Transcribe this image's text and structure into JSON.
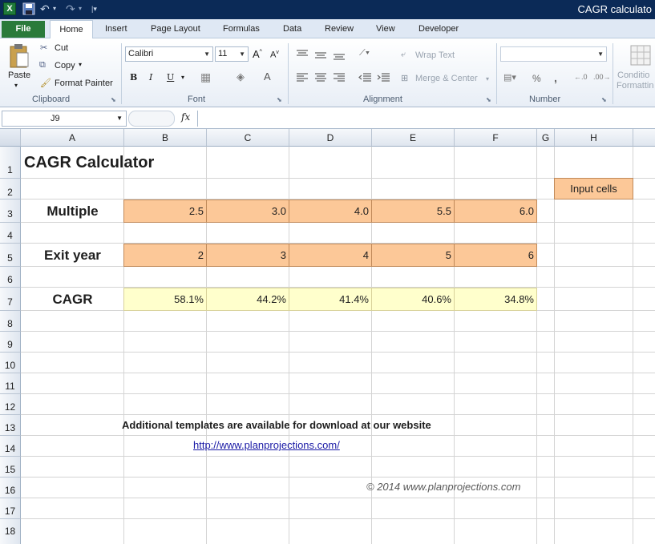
{
  "window": {
    "title": "CAGR calculato"
  },
  "tabs": [
    "File",
    "Home",
    "Insert",
    "Page Layout",
    "Formulas",
    "Data",
    "Review",
    "View",
    "Developer"
  ],
  "ribbon": {
    "clipboard": {
      "paste": "Paste",
      "cut": "Cut",
      "copy": "Copy",
      "format_painter": "Format Painter",
      "group": "Clipboard"
    },
    "font": {
      "name": "Calibri",
      "size": "11",
      "bold": "B",
      "italic": "I",
      "underline": "U",
      "group": "Font"
    },
    "alignment": {
      "wrap": "Wrap Text",
      "merge": "Merge & Center",
      "group": "Alignment"
    },
    "number": {
      "group": "Number",
      "percent": "%",
      "comma": ","
    },
    "styles": {
      "conditional_line1": "Conditio",
      "conditional_line2": "Formattin"
    }
  },
  "formula_bar": {
    "name_box": "J9",
    "fx": "fx",
    "value": ""
  },
  "columns": [
    "A",
    "B",
    "C",
    "D",
    "E",
    "F",
    "G",
    "H"
  ],
  "rows": [
    "1",
    "2",
    "3",
    "4",
    "5",
    "6",
    "7",
    "8",
    "9",
    "10",
    "11",
    "12",
    "13",
    "14",
    "15",
    "16",
    "17",
    "18"
  ],
  "sheet": {
    "title": "CAGR Calculator",
    "input_legend": "Input cells",
    "multiple_label": "Multiple",
    "multiples": [
      "2.5",
      "3.0",
      "4.0",
      "5.5",
      "6.0"
    ],
    "exit_label": "Exit year",
    "exit_years": [
      "2",
      "3",
      "4",
      "5",
      "6"
    ],
    "cagr_label": "CAGR",
    "cagr_values": [
      "58.1%",
      "44.2%",
      "41.4%",
      "40.6%",
      "34.8%"
    ],
    "templates_note": "Additional templates are available for download at our website",
    "website": "http://www.planprojections.com/",
    "copyright": "© 2014 www.planprojections.com"
  },
  "colors": {
    "input_fill": "#fcc898",
    "output_fill": "#ffffcc",
    "file_tab": "#2a7a3a",
    "titlebar": "#0b2a57"
  }
}
